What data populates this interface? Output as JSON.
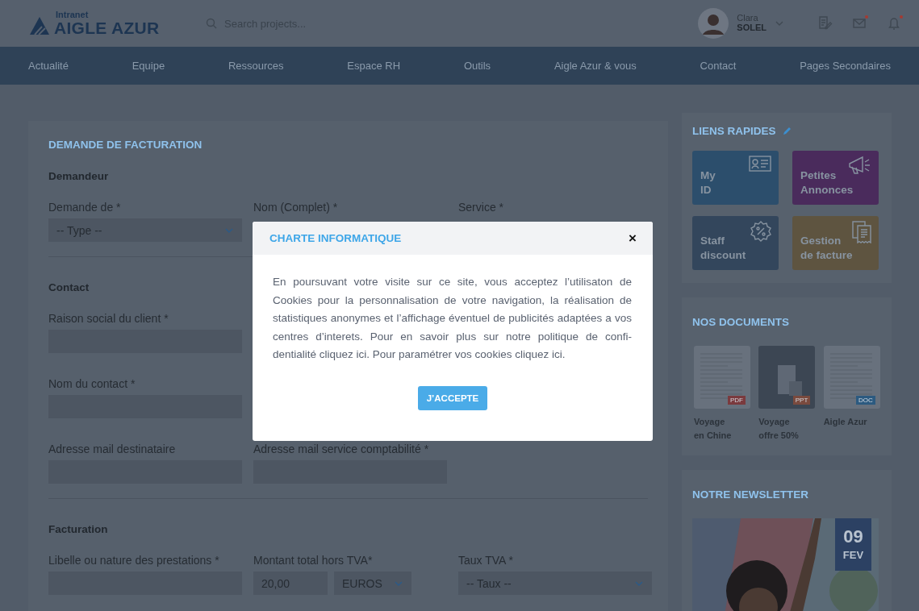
{
  "header": {
    "logo": {
      "tagline": "Intranet",
      "brand": "AIGLE AZUR"
    },
    "search": {
      "placeholder": "Search projects..."
    },
    "user": {
      "first_name": "Clara",
      "last_name": "SOLEL"
    },
    "icons": [
      {
        "kind": "document",
        "unread": false
      },
      {
        "kind": "mail",
        "unread": true
      },
      {
        "kind": "bell",
        "unread": true
      }
    ]
  },
  "nav": [
    "Actualité",
    "Equipe",
    "Ressources",
    "Espace RH",
    "Outils",
    "Aigle Azur & vous",
    "Contact",
    "Pages Secondaires"
  ],
  "form": {
    "title": "DEMANDE DE FACTURATION",
    "sections": [
      {
        "title": "Demandeur",
        "rows": [
          [
            {
              "label": "Demande de *",
              "kind": "select",
              "value": "-- Type --"
            },
            {
              "label": "Nom (Complet) *",
              "kind": "label"
            },
            {
              "label": "Service *",
              "kind": "label"
            }
          ]
        ]
      },
      {
        "title": "Contact",
        "rows": [
          [
            {
              "label": "Raison social du client *",
              "kind": "text"
            }
          ],
          [
            {
              "label": "Nom du contact *",
              "kind": "text"
            }
          ],
          [
            {
              "label": "Adresse mail destinataire",
              "kind": "text"
            },
            {
              "label": "Adresse mail service comptabilité *",
              "kind": "text"
            }
          ]
        ]
      },
      {
        "title": "Facturation",
        "rows": [
          [
            {
              "label": "Libelle ou nature des prestations *",
              "kind": "text"
            },
            {
              "label": "Montant total hors TVA*",
              "kind": "amount",
              "value": "20,00",
              "currency": "EUROS"
            },
            {
              "label": "Taux TVA *",
              "kind": "select",
              "value": "-- Taux --"
            }
          ]
        ]
      }
    ]
  },
  "quick_links": {
    "title": "LIENS RAPIDES",
    "items": [
      {
        "label": "My\nID",
        "color": "#2c4e6c"
      },
      {
        "label": "Petites\nAnnonces",
        "color": "#4a2b5c"
      },
      {
        "label": "Staff\ndiscount",
        "color": "#33465c"
      },
      {
        "label": "Gestion\nde facture",
        "color": "#5e5440"
      }
    ]
  },
  "documents": {
    "title": "NOS DOCUMENTS",
    "items": [
      {
        "name": "Voyage\nen Chine",
        "file_type": "PDF"
      },
      {
        "name": "Voyage\noffre 50%",
        "file_type": "PPT"
      },
      {
        "name": "Aigle Azur",
        "file_type": "DOC"
      }
    ]
  },
  "newsletter": {
    "title": "NOTRE NEWSLETTER",
    "date": {
      "day": "09",
      "month": "FEV"
    }
  },
  "modal": {
    "title": "CHARTE INFORMATIQUE",
    "close": "×",
    "text": "En poursuvant votre visite sur ce site, vous acceptez l’utilisaton de Cookies pour la personnalisation de votre navigation, la réalisation de statistiques anonymes et l’affichage éventuel de publicités adaptées a vos centres d’interets. Pour en savoir plus sur notre politique de confi-dentialité cliquez ici. Pour paramétrer vos cookies cliquez ici.",
    "button": "J’ACCEPTE"
  }
}
